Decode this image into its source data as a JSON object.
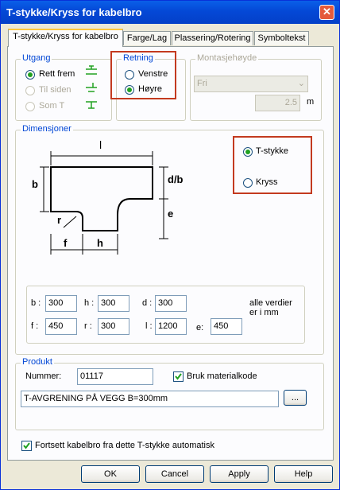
{
  "window": {
    "title": "T-stykke/Kryss for kabelbro",
    "close_glyph": "✕"
  },
  "tabs": [
    {
      "label": "T-stykke/Kryss for kabelbro",
      "active": true
    },
    {
      "label": "Farge/Lag",
      "active": false
    },
    {
      "label": "Plassering/Rotering",
      "active": false
    },
    {
      "label": "Symboltekst",
      "active": false
    }
  ],
  "utgang": {
    "legend": "Utgang",
    "options": [
      {
        "label": "Rett frem",
        "selected": true,
        "enabled": true
      },
      {
        "label": "Til siden",
        "selected": false,
        "enabled": false
      },
      {
        "label": "Som T",
        "selected": false,
        "enabled": false
      }
    ]
  },
  "retning": {
    "legend": "Retning",
    "options": [
      {
        "label": "Venstre",
        "selected": false
      },
      {
        "label": "Høyre",
        "selected": true
      }
    ]
  },
  "montasje": {
    "legend": "Montasjehøyde",
    "select_value": "Fri",
    "height_value": "2.5",
    "unit": "m"
  },
  "dimensjoner": {
    "legend": "Dimensjoner",
    "diagram_labels": {
      "l": "l",
      "b": "b",
      "db": "d/b",
      "e": "e",
      "r": "r",
      "f": "f",
      "h": "h"
    },
    "type_options": [
      {
        "label": "T-stykke",
        "selected": true
      },
      {
        "label": "Kryss",
        "selected": false
      }
    ],
    "fields": {
      "b": {
        "label": "b :",
        "value": "300"
      },
      "h": {
        "label": "h :",
        "value": "300"
      },
      "d": {
        "label": "d :",
        "value": "300"
      },
      "f": {
        "label": "f :",
        "value": "450"
      },
      "r": {
        "label": "r :",
        "value": "300"
      },
      "l": {
        "label": "l :",
        "value": "1200"
      },
      "e": {
        "label": "e:",
        "value": "450"
      }
    },
    "note": "alle verdier er i mm"
  },
  "produkt": {
    "legend": "Produkt",
    "nummer_label": "Nummer:",
    "nummer_value": "01117",
    "bruk_label": "Bruk materialkode",
    "bruk_checked": true,
    "description": "T-AVGRENING PÅ VEGG B=300mm",
    "browse_label": "..."
  },
  "fortsett": {
    "label": "Fortsett kabelbro fra dette T-stykke automatisk",
    "checked": true
  },
  "buttons": {
    "ok": "OK",
    "cancel": "Cancel",
    "apply": "Apply",
    "help": "Help"
  }
}
